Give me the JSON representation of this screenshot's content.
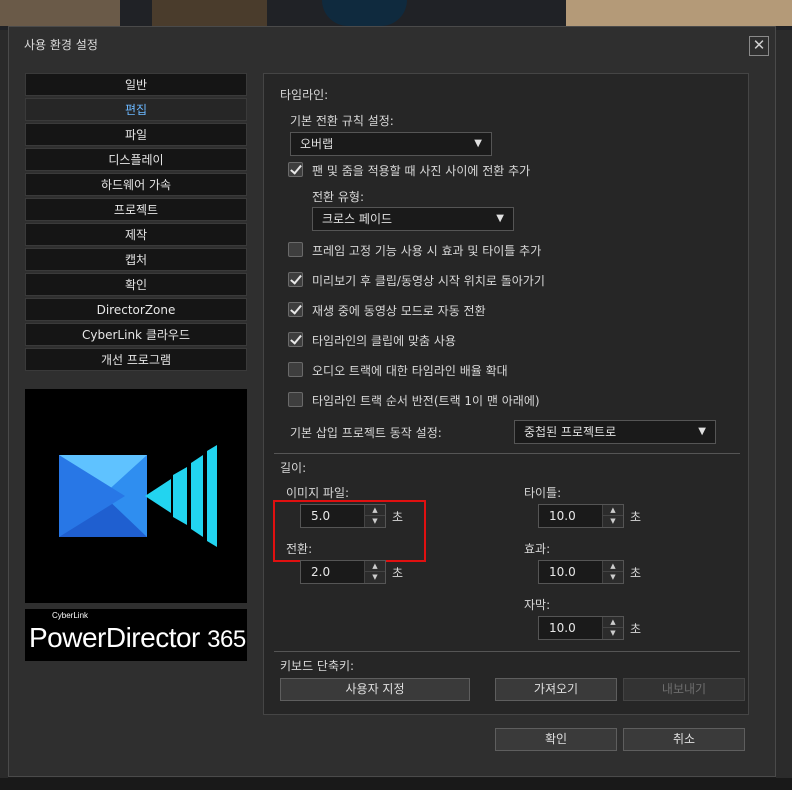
{
  "dialog": {
    "title": "사용 환경 설정"
  },
  "sidebar": {
    "items": [
      {
        "label": "일반"
      },
      {
        "label": "편집"
      },
      {
        "label": "파일"
      },
      {
        "label": "디스플레이"
      },
      {
        "label": "하드웨어 가속"
      },
      {
        "label": "프로젝트"
      },
      {
        "label": "제작"
      },
      {
        "label": "캡처"
      },
      {
        "label": "확인"
      },
      {
        "label": "DirectorZone"
      },
      {
        "label": "CyberLink 클라우드"
      },
      {
        "label": "개선 프로그램"
      }
    ],
    "active_index": 1
  },
  "brand": {
    "small": "CyberLink",
    "name": "PowerDirector",
    "version": "365"
  },
  "timeline": {
    "heading": "타임라인:",
    "transition_rule_label": "기본 전환 규칙 설정:",
    "transition_rule_value": "오버랩",
    "pan_zoom_label": "팬 및 줌을 적용할 때 사진 사이에 전환 추가",
    "pan_zoom_checked": true,
    "transition_type_label": "전환 유형:",
    "transition_type_value": "크로스 페이드",
    "options": [
      {
        "label": "프레임 고정 기능 사용 시 효과 및 타이틀 추가",
        "checked": false
      },
      {
        "label": "미리보기 후 클립/동영상 시작 위치로 돌아가기",
        "checked": true
      },
      {
        "label": "재생 중에 동영상 모드로 자동 전환",
        "checked": true
      },
      {
        "label": "타임라인의 클립에 맞춤 사용",
        "checked": true
      },
      {
        "label": "오디오 트랙에 대한 타임라인 배율 확대",
        "checked": false
      },
      {
        "label": "타임라인 트랙 순서 반전(트랙 1이 맨 아래에)",
        "checked": false
      }
    ],
    "insert_project_label": "기본 삽입 프로젝트 동작 설정:",
    "insert_project_value": "중첩된 프로젝트로"
  },
  "duration": {
    "heading": "길이:",
    "unit": "초",
    "image_label": "이미지 파일:",
    "image_value": "5.0",
    "transition_label": "전환:",
    "transition_value": "2.0",
    "title_label": "타이틀:",
    "title_value": "10.0",
    "effect_label": "효과:",
    "effect_value": "10.0",
    "subtitle_label": "자막:",
    "subtitle_value": "10.0"
  },
  "keyboard": {
    "heading": "키보드 단축키:",
    "customize": "사용자 지정",
    "import": "가져오기",
    "export": "내보내기"
  },
  "footer": {
    "ok": "확인",
    "cancel": "취소"
  },
  "colors": {
    "highlight": "#e01010",
    "active_item": "#6bb8ff",
    "logo_blue": "#2f8ef0"
  }
}
